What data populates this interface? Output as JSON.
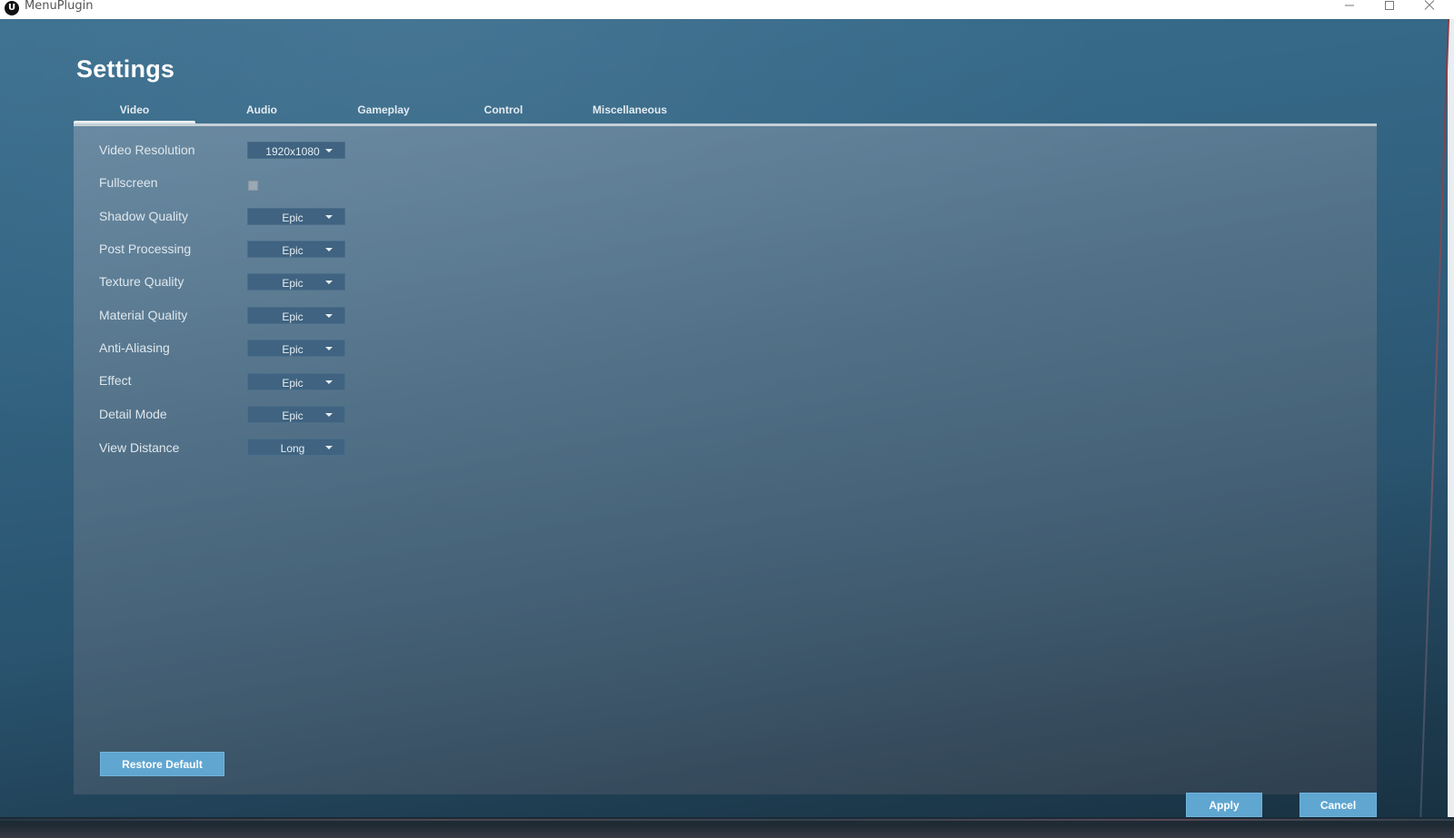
{
  "window": {
    "title": "MenuPlugin",
    "logo_glyph": "U",
    "controls": [
      "minimize-icon",
      "maximize-icon",
      "close-icon"
    ]
  },
  "settings": {
    "title": "Settings",
    "tabs": [
      {
        "label": "Video",
        "active": true
      },
      {
        "label": "Audio",
        "active": false
      },
      {
        "label": "Gameplay",
        "active": false
      },
      {
        "label": "Control",
        "active": false
      },
      {
        "label": "Miscellaneous",
        "active": false
      }
    ],
    "video": {
      "rows": [
        {
          "label": "Video Resolution",
          "type": "dropdown",
          "value": "1920x1080"
        },
        {
          "label": "Fullscreen",
          "type": "checkbox",
          "checked": false
        },
        {
          "label": "Shadow Quality",
          "type": "dropdown",
          "value": "Epic"
        },
        {
          "label": "Post Processing",
          "type": "dropdown",
          "value": "Epic"
        },
        {
          "label": "Texture Quality",
          "type": "dropdown",
          "value": "Epic"
        },
        {
          "label": "Material Quality",
          "type": "dropdown",
          "value": "Epic"
        },
        {
          "label": "Anti-Aliasing",
          "type": "dropdown",
          "value": "Epic"
        },
        {
          "label": "Effect",
          "type": "dropdown",
          "value": "Epic"
        },
        {
          "label": "Detail Mode",
          "type": "dropdown",
          "value": "Epic"
        },
        {
          "label": "View Distance",
          "type": "dropdown",
          "value": "Long"
        }
      ]
    },
    "buttons": {
      "restore_default": "Restore Default",
      "apply": "Apply",
      "cancel": "Cancel"
    }
  },
  "colors": {
    "accent_button": "#5fa6d1",
    "dropdown_bg": "#3f6380",
    "background_top": "#3b6f8f",
    "background_bottom": "#183040"
  }
}
